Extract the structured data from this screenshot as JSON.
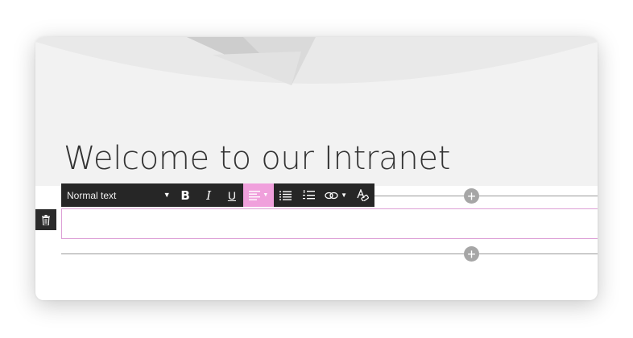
{
  "page": {
    "title": "Welcome to our Intranet"
  },
  "toolbar": {
    "text_style": "Normal text",
    "buttons": {
      "bold": "B",
      "italic": "I",
      "underline": "U",
      "align": "align-left-icon",
      "bullets": "bulleted-list-icon",
      "numbering": "numbered-list-icon",
      "link": "link-icon",
      "clear_format": "clear-formatting-icon"
    },
    "active_button": "align"
  },
  "canvas": {
    "add_section_icon": "plus-icon",
    "delete_icon": "trash-icon"
  },
  "colors": {
    "toolbar_bg": "#262626",
    "active_highlight": "#f0a0dc",
    "edit_border": "#dd9fd6",
    "header_bg": "#f2f2f2",
    "title_text": "#333333"
  }
}
